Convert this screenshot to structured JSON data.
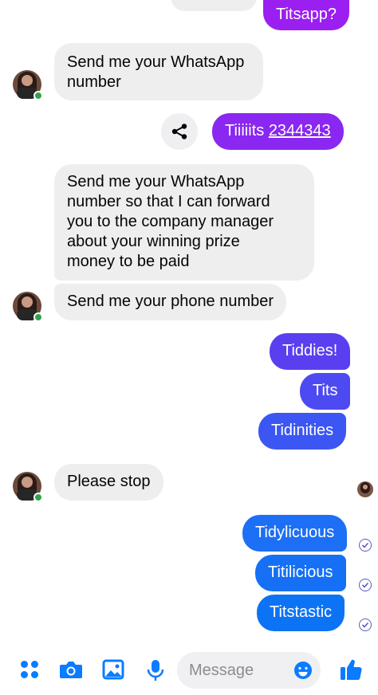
{
  "messages": {
    "m0": "Titsapp?",
    "m1_l1": "Send me your WhatsApp",
    "m1_l2": "number",
    "m2_prefix": "Tiiiiits ",
    "m2_link": "2344343",
    "m3_l1": "Send me your WhatsApp",
    "m3_l2": "number so that I can forward",
    "m3_l3": "you to the company manager",
    "m3_l4": "about your winning prize",
    "m3_l5": "money to be paid",
    "m4": "Send me your phone number",
    "m5": "Tiddies!",
    "m6": "Tits",
    "m7": "Tidinities",
    "m8": "Please stop",
    "m9": "Tidylicuous",
    "m10": "Titilicious",
    "m11": "Titstastic"
  },
  "composer": {
    "placeholder": "Message"
  },
  "colors": {
    "accent": "#0a7cff",
    "purple": "#9b1ff0",
    "violet": "#5a3ff0",
    "indigo": "#3b56f2",
    "blue": "#1570f5",
    "incoming_bubble": "#eeeeef",
    "online": "#31a24c"
  },
  "icons": [
    "apps-icon",
    "camera-icon",
    "gallery-icon",
    "microphone-icon",
    "emoji-icon",
    "thumbs-up-icon",
    "share-icon",
    "seen-check-icon"
  ]
}
